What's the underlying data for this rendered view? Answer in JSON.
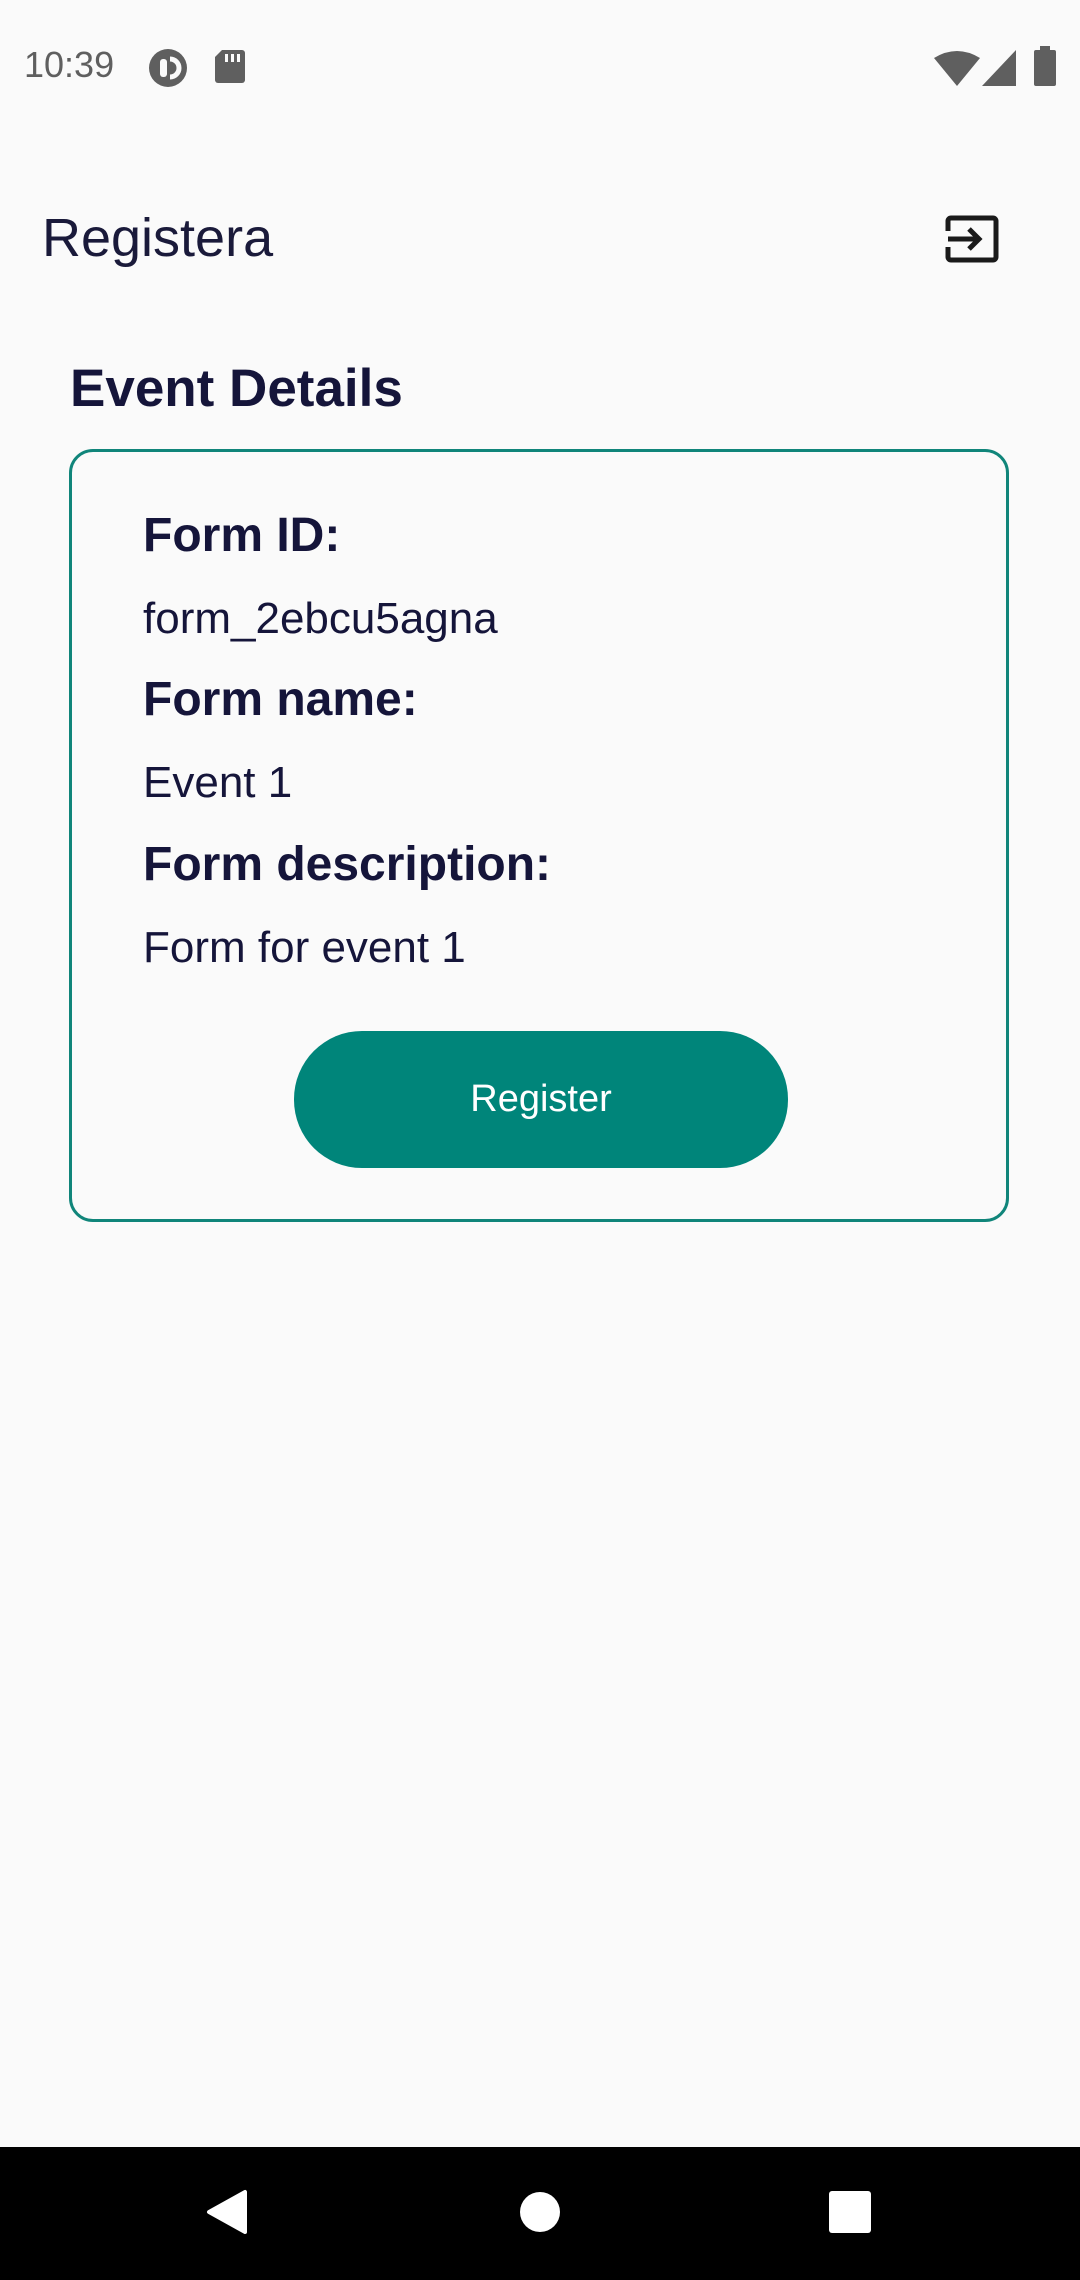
{
  "status_bar": {
    "time": "10:39",
    "icons": [
      "pocket-casts-icon",
      "sd-card-icon",
      "wifi-icon",
      "signal-icon",
      "battery-icon"
    ]
  },
  "app_bar": {
    "title": "Registera",
    "action_icon": "logout-icon"
  },
  "main": {
    "section_title": "Event Details",
    "card": {
      "fields": [
        {
          "label": "Form ID:",
          "value": "form_2ebcu5agna"
        },
        {
          "label": "Form name:",
          "value": "Event 1"
        },
        {
          "label": "Form description:",
          "value": "Form for event 1"
        }
      ],
      "register_label": "Register"
    }
  },
  "nav_bar": {
    "icons": [
      "back-icon",
      "home-icon",
      "recents-icon"
    ]
  },
  "colors": {
    "accent": "#00857a",
    "text": "#15153a",
    "background": "#fafafa"
  }
}
